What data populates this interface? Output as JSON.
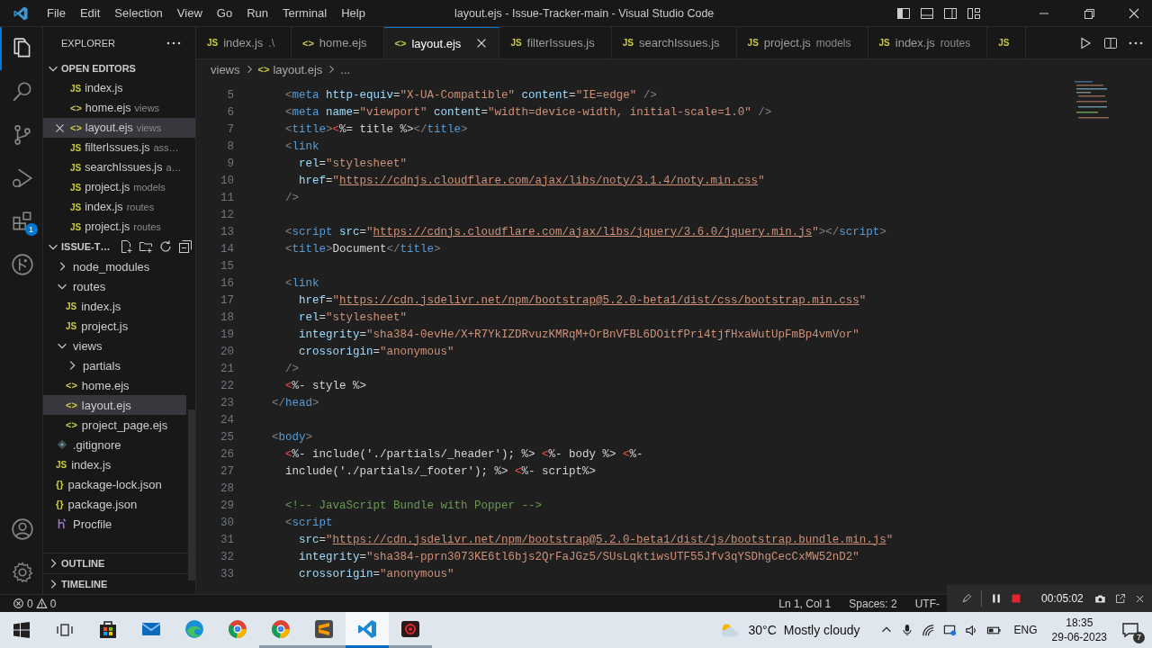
{
  "title_bar": {
    "menu": [
      "File",
      "Edit",
      "Selection",
      "View",
      "Go",
      "Run",
      "Terminal",
      "Help"
    ],
    "title": "layout.ejs - Issue-Tracker-main - Visual Studio Code"
  },
  "activity_bar": [
    {
      "kind": "explorer",
      "selected": true
    },
    {
      "kind": "search",
      "selected": false
    },
    {
      "kind": "source-control",
      "selected": false
    },
    {
      "kind": "run-debug",
      "selected": false
    },
    {
      "kind": "extensions",
      "selected": false,
      "badge": "1"
    },
    {
      "kind": "git-graph",
      "selected": false
    }
  ],
  "explorer": {
    "title": "EXPLORER",
    "open_editors": {
      "title": "OPEN EDITORS",
      "expanded": true,
      "items": [
        {
          "kind": "js",
          "icon": "JS",
          "name": "index.js",
          "selected": false
        },
        {
          "kind": "ejs",
          "icon": "<>",
          "name": "home.ejs",
          "description": "views",
          "selected": false
        },
        {
          "kind": "ejs",
          "icon": "<>",
          "name": "layout.ejs",
          "description": "views",
          "selected": true
        },
        {
          "kind": "js",
          "icon": "JS",
          "name": "filterIssues.js",
          "description": "ass…",
          "selected": false
        },
        {
          "kind": "js",
          "icon": "JS",
          "name": "searchIssues.js",
          "description": "a…",
          "selected": false
        },
        {
          "kind": "js",
          "icon": "JS",
          "name": "project.js",
          "description": "models",
          "selected": false
        },
        {
          "kind": "js",
          "icon": "JS",
          "name": "index.js",
          "description": "routes",
          "selected": false
        },
        {
          "kind": "js",
          "icon": "JS",
          "name": "project.js",
          "description": "routes",
          "selected": false
        }
      ]
    },
    "folder": {
      "title": "ISSUE-T…",
      "expanded": true,
      "tree": [
        {
          "kind": "folder",
          "name": "node_modules",
          "expanded": false
        },
        {
          "kind": "folder",
          "name": "routes",
          "expanded": true,
          "children": [
            {
              "kind": "js",
              "icon": "JS",
              "name": "index.js",
              "selected": false
            },
            {
              "kind": "js",
              "icon": "JS",
              "name": "project.js",
              "selected": false
            }
          ]
        },
        {
          "kind": "folder",
          "name": "views",
          "expanded": true,
          "children": [
            {
              "kind": "folder",
              "name": "partials",
              "expanded": false
            },
            {
              "kind": "ejs",
              "icon": "<>",
              "name": "home.ejs",
              "selected": false
            },
            {
              "kind": "ejs",
              "icon": "<>",
              "name": "layout.ejs",
              "selected": true
            },
            {
              "kind": "ejs",
              "icon": "<>",
              "name": "project_page.ejs",
              "selected": false
            }
          ]
        },
        {
          "kind": "git",
          "name": ".gitignore",
          "selected": false
        },
        {
          "kind": "js",
          "icon": "JS",
          "name": "index.js",
          "selected": false
        },
        {
          "kind": "json",
          "icon": "{}",
          "name": "package-lock.json",
          "selected": false
        },
        {
          "kind": "json",
          "icon": "{}",
          "name": "package.json",
          "selected": false
        },
        {
          "kind": "heroku",
          "name": "Procfile",
          "selected": false
        }
      ]
    },
    "sections": [
      {
        "title": "OUTLINE",
        "expanded": false
      },
      {
        "title": "TIMELINE",
        "expanded": false
      }
    ]
  },
  "tabs": [
    {
      "kind": "js",
      "icon": "JS",
      "label": "index.js",
      "description": ".\\",
      "selected": false
    },
    {
      "kind": "ejs",
      "icon": "<>",
      "label": "home.ejs",
      "selected": false
    },
    {
      "kind": "ejs",
      "icon": "<>",
      "label": "layout.ejs",
      "selected": true
    },
    {
      "kind": "js",
      "icon": "JS",
      "label": "filterIssues.js",
      "selected": false
    },
    {
      "kind": "js",
      "icon": "JS",
      "label": "searchIssues.js",
      "selected": false
    },
    {
      "kind": "js",
      "icon": "JS",
      "label": "project.js",
      "description": "models",
      "selected": false
    },
    {
      "kind": "js",
      "icon": "JS",
      "label": "index.js",
      "description": "routes",
      "selected": false
    },
    {
      "kind": "js",
      "icon": "JS",
      "selected": false
    }
  ],
  "breadcrumb": [
    {
      "label": "views"
    },
    {
      "kind": "ejs",
      "icon": "<>",
      "label": "layout.ejs"
    },
    {
      "label": "..."
    }
  ],
  "code": [
    {
      "number": "5",
      "tokens": [
        {
          "kind": "punct",
          "text": "    <"
        },
        {
          "kind": "tag",
          "text": "meta"
        },
        {
          "kind": "attr",
          "text": " http-equiv"
        },
        {
          "kind": "plain",
          "text": "="
        },
        {
          "kind": "string",
          "text": "\"X-UA-Compatible\""
        },
        {
          "kind": "attr",
          "text": " content"
        },
        {
          "kind": "plain",
          "text": "="
        },
        {
          "kind": "string",
          "text": "\"IE=edge\""
        },
        {
          "kind": "punct",
          "text": " />"
        }
      ]
    },
    {
      "number": "6",
      "tokens": [
        {
          "kind": "punct",
          "text": "    <"
        },
        {
          "kind": "tag",
          "text": "meta"
        },
        {
          "kind": "attr",
          "text": " name"
        },
        {
          "kind": "plain",
          "text": "="
        },
        {
          "kind": "string",
          "text": "\"viewport\""
        },
        {
          "kind": "attr",
          "text": " content"
        },
        {
          "kind": "plain",
          "text": "="
        },
        {
          "kind": "string",
          "text": "\"width=device-width, initial-scale=1.0\""
        },
        {
          "kind": "punct",
          "text": " />"
        }
      ]
    },
    {
      "number": "7",
      "tokens": [
        {
          "kind": "punct",
          "text": "    <"
        },
        {
          "kind": "tag",
          "text": "title"
        },
        {
          "kind": "punct",
          "text": ">"
        },
        {
          "kind": "ejs",
          "text": "<"
        },
        {
          "kind": "plain",
          "text": "%= title %>"
        },
        {
          "kind": "punct",
          "text": "</"
        },
        {
          "kind": "tag",
          "text": "title"
        },
        {
          "kind": "punct",
          "text": ">"
        }
      ]
    },
    {
      "number": "8",
      "tokens": [
        {
          "kind": "punct",
          "text": "    <"
        },
        {
          "kind": "tag",
          "text": "link"
        }
      ]
    },
    {
      "number": "9",
      "tokens": [
        {
          "kind": "attr",
          "text": "      rel"
        },
        {
          "kind": "plain",
          "text": "="
        },
        {
          "kind": "string",
          "text": "\"stylesheet\""
        }
      ]
    },
    {
      "number": "10",
      "tokens": [
        {
          "kind": "attr",
          "text": "      href"
        },
        {
          "kind": "plain",
          "text": "="
        },
        {
          "kind": "string",
          "text": "\""
        },
        {
          "kind": "url",
          "text": "https://cdnjs.cloudflare.com/ajax/libs/noty/3.1.4/noty.min.css"
        },
        {
          "kind": "string",
          "text": "\""
        }
      ]
    },
    {
      "number": "11",
      "tokens": [
        {
          "kind": "punct",
          "text": "    />"
        }
      ]
    },
    {
      "number": "12"
    },
    {
      "number": "13",
      "tokens": [
        {
          "kind": "punct",
          "text": "    <"
        },
        {
          "kind": "tag",
          "text": "script"
        },
        {
          "kind": "attr",
          "text": " src"
        },
        {
          "kind": "plain",
          "text": "="
        },
        {
          "kind": "string",
          "text": "\""
        },
        {
          "kind": "url",
          "text": "https://cdnjs.cloudflare.com/ajax/libs/jquery/3.6.0/jquery.min.js"
        },
        {
          "kind": "string",
          "text": "\""
        },
        {
          "kind": "punct",
          "text": "></"
        },
        {
          "kind": "tag",
          "text": "script"
        },
        {
          "kind": "punct",
          "text": ">"
        }
      ]
    },
    {
      "number": "14",
      "tokens": [
        {
          "kind": "punct",
          "text": "    <"
        },
        {
          "kind": "tag",
          "text": "title"
        },
        {
          "kind": "punct",
          "text": ">"
        },
        {
          "kind": "plain",
          "text": "Document"
        },
        {
          "kind": "punct",
          "text": "</"
        },
        {
          "kind": "tag",
          "text": "title"
        },
        {
          "kind": "punct",
          "text": ">"
        }
      ]
    },
    {
      "number": "15"
    },
    {
      "number": "16",
      "tokens": [
        {
          "kind": "punct",
          "text": "    <"
        },
        {
          "kind": "tag",
          "text": "link"
        }
      ]
    },
    {
      "number": "17",
      "tokens": [
        {
          "kind": "attr",
          "text": "      href"
        },
        {
          "kind": "plain",
          "text": "="
        },
        {
          "kind": "string",
          "text": "\""
        },
        {
          "kind": "url",
          "text": "https://cdn.jsdelivr.net/npm/bootstrap@5.2.0-beta1/dist/css/bootstrap.min.css"
        },
        {
          "kind": "string",
          "text": "\""
        }
      ]
    },
    {
      "number": "18",
      "tokens": [
        {
          "kind": "attr",
          "text": "      rel"
        },
        {
          "kind": "plain",
          "text": "="
        },
        {
          "kind": "string",
          "text": "\"stylesheet\""
        }
      ]
    },
    {
      "number": "19",
      "tokens": [
        {
          "kind": "attr",
          "text": "      integrity"
        },
        {
          "kind": "plain",
          "text": "="
        },
        {
          "kind": "string",
          "text": "\"sha384-0evHe/X+R7YkIZDRvuzKMRqM+OrBnVFBL6DOitfPri4tjfHxaWutUpFmBp4vmVor\""
        }
      ]
    },
    {
      "number": "20",
      "tokens": [
        {
          "kind": "attr",
          "text": "      crossorigin"
        },
        {
          "kind": "plain",
          "text": "="
        },
        {
          "kind": "string",
          "text": "\"anonymous\""
        }
      ]
    },
    {
      "number": "21",
      "tokens": [
        {
          "kind": "punct",
          "text": "    />"
        }
      ]
    },
    {
      "number": "22",
      "tokens": [
        {
          "kind": "ejs",
          "text": "    <"
        },
        {
          "kind": "plain",
          "text": "%- style %>"
        }
      ]
    },
    {
      "number": "23",
      "tokens": [
        {
          "kind": "punct",
          "text": "  </"
        },
        {
          "kind": "tag",
          "text": "head"
        },
        {
          "kind": "punct",
          "text": ">"
        }
      ]
    },
    {
      "number": "24"
    },
    {
      "number": "25",
      "tokens": [
        {
          "kind": "punct",
          "text": "  <"
        },
        {
          "kind": "tag",
          "text": "body"
        },
        {
          "kind": "punct",
          "text": ">"
        }
      ]
    },
    {
      "number": "26",
      "tokens": [
        {
          "kind": "ejs",
          "text": "    <"
        },
        {
          "kind": "plain",
          "text": "%- include('./partials/_header'); %> "
        },
        {
          "kind": "ejs",
          "text": "<"
        },
        {
          "kind": "plain",
          "text": "%- body %> "
        },
        {
          "kind": "ejs",
          "text": "<"
        },
        {
          "kind": "plain",
          "text": "%-"
        }
      ]
    },
    {
      "number": "27",
      "tokens": [
        {
          "kind": "plain",
          "text": "    include('./partials/_footer'); %> "
        },
        {
          "kind": "ejs",
          "text": "<"
        },
        {
          "kind": "plain",
          "text": "%- script%>"
        }
      ]
    },
    {
      "number": "28"
    },
    {
      "number": "29",
      "tokens": [
        {
          "kind": "comment",
          "text": "    <!-- JavaScript Bundle with Popper -->"
        }
      ]
    },
    {
      "number": "30",
      "tokens": [
        {
          "kind": "punct",
          "text": "    <"
        },
        {
          "kind": "tag",
          "text": "script"
        }
      ]
    },
    {
      "number": "31",
      "tokens": [
        {
          "kind": "attr",
          "text": "      src"
        },
        {
          "kind": "plain",
          "text": "="
        },
        {
          "kind": "string",
          "text": "\""
        },
        {
          "kind": "url",
          "text": "https://cdn.jsdelivr.net/npm/bootstrap@5.2.0-beta1/dist/js/bootstrap.bundle.min.js"
        },
        {
          "kind": "string",
          "text": "\""
        }
      ]
    },
    {
      "number": "32",
      "tokens": [
        {
          "kind": "attr",
          "text": "      integrity"
        },
        {
          "kind": "plain",
          "text": "="
        },
        {
          "kind": "string",
          "text": "\"sha384-pprn3073KE6tl6bjs2QrFaJGz5/SUsLqktiwsUTF55Jfv3qYSDhgCecCxMW52nD2\""
        }
      ]
    },
    {
      "number": "33",
      "tokens": [
        {
          "kind": "attr",
          "text": "      crossorigin"
        },
        {
          "kind": "plain",
          "text": "="
        },
        {
          "kind": "string",
          "text": "\"anonymous\""
        }
      ]
    }
  ],
  "status_bar": {
    "errors": "0",
    "warnings": "0",
    "items": [
      "Ln 1, Col 1",
      "Spaces: 2",
      "UTF-"
    ]
  },
  "recorder": {
    "timer": "00:05:02"
  },
  "taskbar": {
    "apps": [
      {
        "kind": "store",
        "running": false,
        "selected": false
      },
      {
        "kind": "mail",
        "running": false,
        "selected": false
      },
      {
        "kind": "edge",
        "running": false,
        "selected": false
      },
      {
        "kind": "chrome",
        "running": false,
        "selected": false
      },
      {
        "kind": "chrome",
        "running": true,
        "selected": false
      },
      {
        "kind": "sublime",
        "running": true,
        "selected": false
      },
      {
        "kind": "vscode",
        "running": true,
        "selected": true
      },
      {
        "kind": "recorder",
        "running": true,
        "selected": false
      }
    ],
    "weather": {
      "temperature": "30°C",
      "condition": "Mostly cloudy"
    },
    "language": "ENG",
    "time": "18:35",
    "date": "29-06-2023",
    "notifications": "7"
  }
}
